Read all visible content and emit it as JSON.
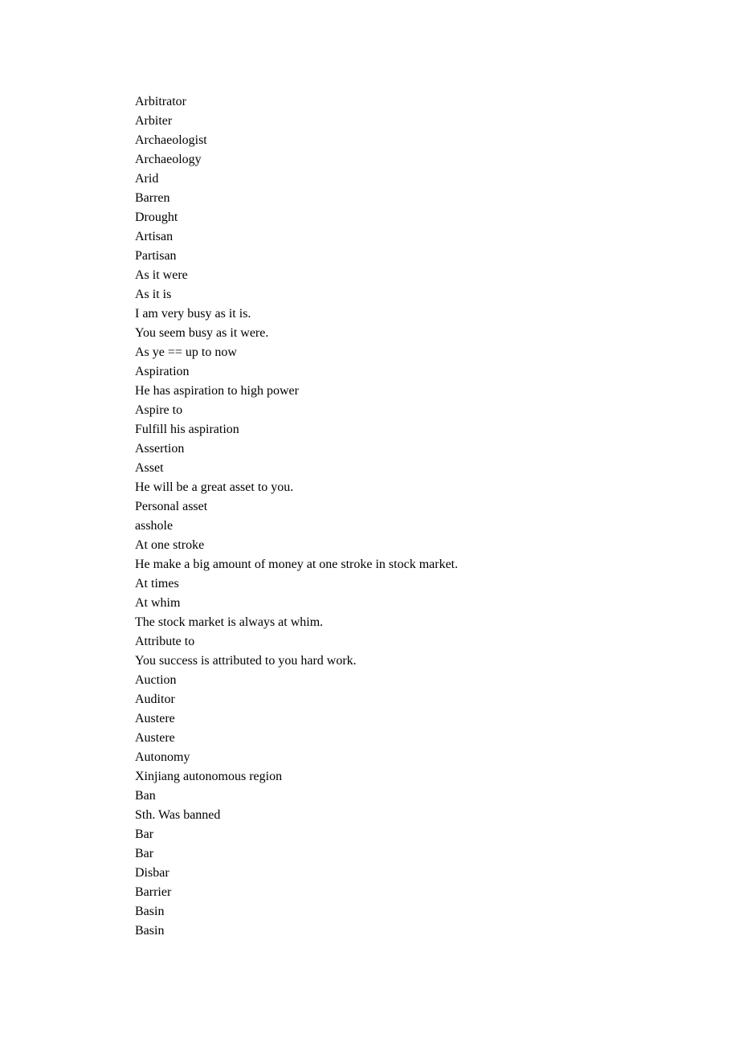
{
  "lines": [
    "Arbitrator",
    "Arbiter",
    "Archaeologist",
    "Archaeology",
    "Arid",
    "Barren",
    "Drought",
    "Artisan",
    "Partisan",
    "As it were",
    "As it is",
    "I am very busy as it is.",
    "You seem busy as it were.",
    "As ye == up to now",
    "Aspiration",
    "He has aspiration to high power",
    "Aspire to",
    "Fulfill his aspiration",
    "Assertion",
    "Asset",
    "He will be a great asset to you.",
    "Personal asset",
    "asshole",
    "At one stroke",
    "He make a big amount of money at one stroke in stock market.",
    "At times",
    "At whim",
    "The stock market is always at whim.",
    "Attribute to",
    "You success is attributed to you hard work.",
    "Auction",
    "Auditor",
    "Austere",
    "Austere",
    "Autonomy",
    "Xinjiang autonomous region",
    "Ban",
    "Sth. Was banned",
    "Bar",
    "Bar",
    "Disbar",
    "Barrier",
    "Basin",
    "Basin"
  ]
}
